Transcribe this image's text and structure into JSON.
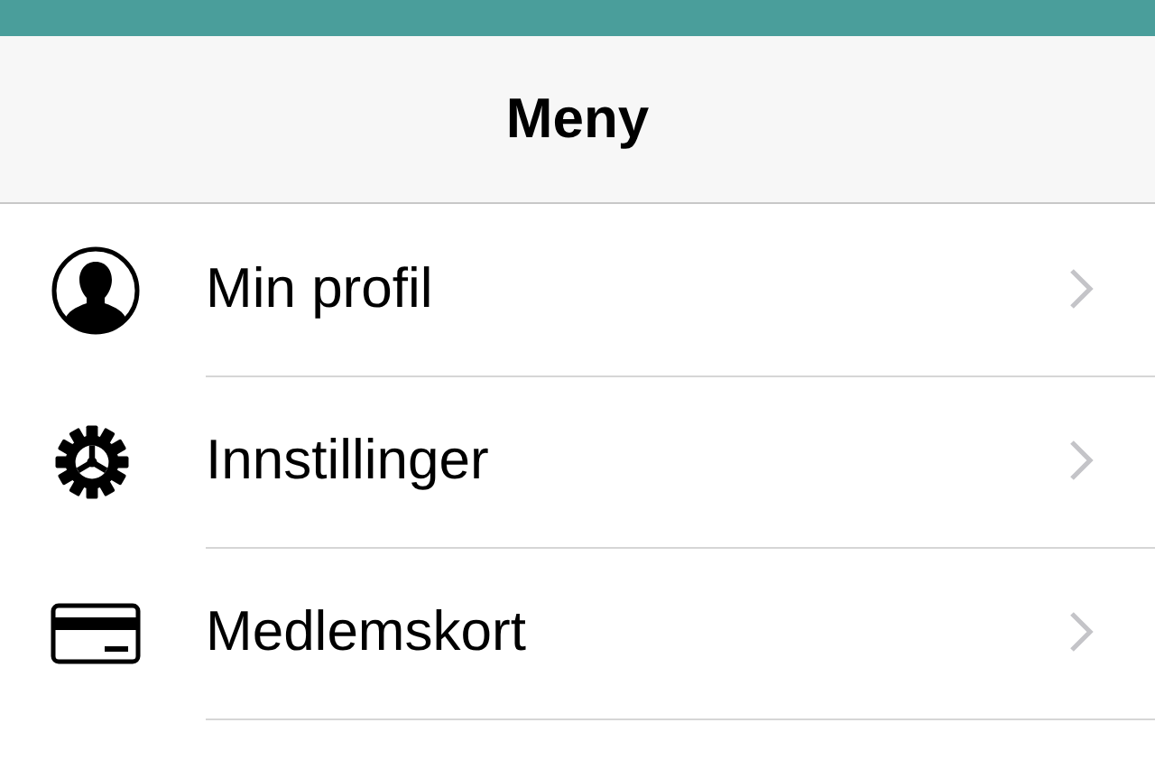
{
  "nav_bar": {
    "title": "Meny"
  },
  "menu": [
    {
      "kind": "profile",
      "label": "Min profil"
    },
    {
      "kind": "settings",
      "label": "Innstillinger"
    },
    {
      "kind": "card",
      "label": "Medlemskort"
    }
  ]
}
